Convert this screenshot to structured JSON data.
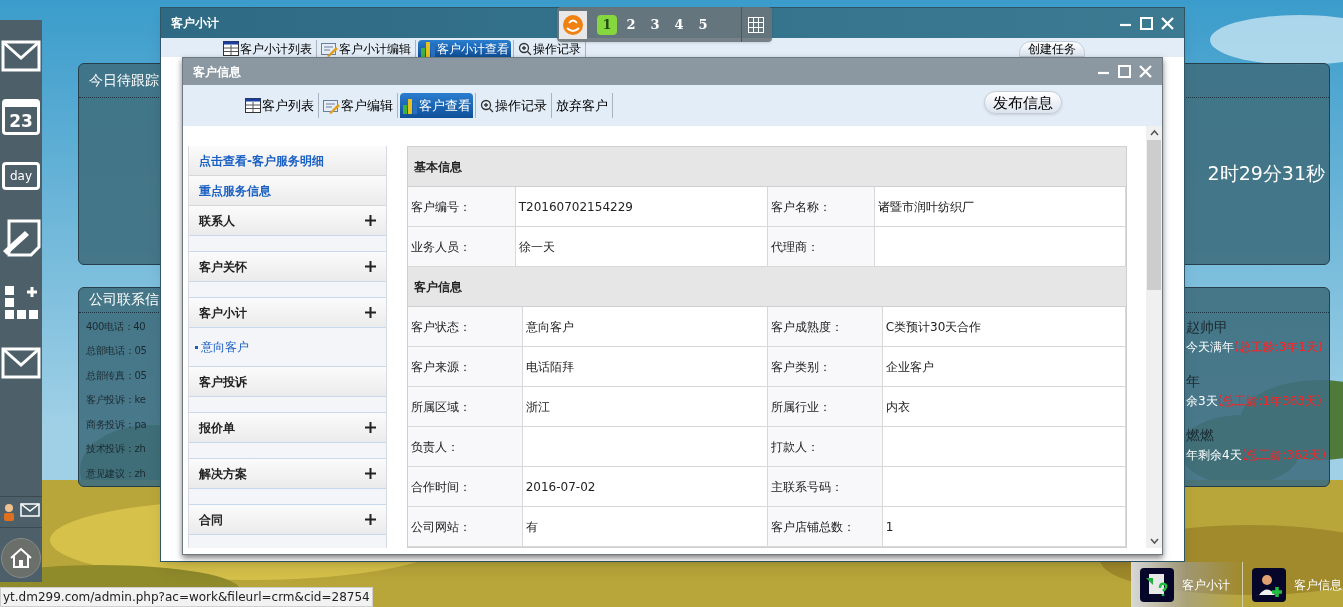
{
  "dock": [
    {
      "kind": "mail"
    },
    {
      "kind": "calendar",
      "label": "23"
    },
    {
      "kind": "day",
      "label": "day"
    },
    {
      "kind": "note"
    },
    {
      "kind": "apps"
    },
    {
      "kind": "mail"
    }
  ],
  "desktop_panels": [
    {
      "title": "今日待跟踪",
      "timer": "2时29分31秒"
    },
    {
      "title": "公司联系信",
      "contacts": [
        "400电话：40",
        "总部电话：05",
        "总部传真：05",
        "客户投诉：ke",
        "商务投诉：pa",
        "技术投诉：zh",
        "意见建议：zh"
      ],
      "anniversaries": [
        {
          "name": "赵帅甲",
          "note": "今天满年",
          "tenure": "(总工龄:3年1天)"
        },
        {
          "name": "年",
          "note": "余3天",
          "tenure": "(总工龄:1年363天)"
        },
        {
          "name": "燃燃",
          "note": "年剩余4天",
          "tenure": "(总工龄:362天)"
        }
      ]
    }
  ],
  "workspace_switcher": [
    {
      "label": "1",
      "selected": true
    },
    {
      "label": "2",
      "selected": false
    },
    {
      "label": "3",
      "selected": false
    },
    {
      "label": "4",
      "selected": false
    },
    {
      "label": "5",
      "selected": false
    }
  ],
  "outer_window": {
    "title": "客户小计",
    "action_button": "创建任务",
    "tabs": [
      {
        "label": "客户小计列表",
        "kind": "table",
        "selected": false
      },
      {
        "label": "客户小计编辑",
        "kind": "edit",
        "selected": false
      },
      {
        "label": "客户小计查看",
        "kind": "view",
        "selected": true
      },
      {
        "label": "操作记录",
        "kind": "zoom",
        "selected": false
      }
    ]
  },
  "inner_window": {
    "title": "客户信息",
    "action_button": "发布信息",
    "tabs": [
      {
        "label": "客户列表",
        "kind": "table",
        "selected": false
      },
      {
        "label": "客户编辑",
        "kind": "edit",
        "selected": false
      },
      {
        "label": "客户查看",
        "kind": "view",
        "selected": true
      },
      {
        "label": "操作记录",
        "kind": "zoom",
        "selected": false
      },
      {
        "label": "放弃客户",
        "kind": "plain",
        "selected": false
      }
    ],
    "sidebar": [
      {
        "label": "点击查看-客户服务明细",
        "kind": "link"
      },
      {
        "label": "重点服务信息",
        "kind": "link"
      },
      {
        "label": "联系人",
        "kind": "section",
        "expandable": true
      },
      {
        "label": "客户关怀",
        "kind": "section",
        "expandable": true
      },
      {
        "label": "客户小计",
        "kind": "section",
        "expandable": true,
        "children": [
          {
            "label": "意向客户"
          }
        ]
      },
      {
        "label": "客户投诉",
        "kind": "section",
        "expandable": false
      },
      {
        "label": "报价单",
        "kind": "section",
        "expandable": true
      },
      {
        "label": "解决方案",
        "kind": "section",
        "expandable": true
      },
      {
        "label": "合同",
        "kind": "section",
        "expandable": true
      }
    ],
    "details": [
      {
        "title": "基本信息",
        "rows": [
          [
            "客户编号：",
            "T20160702154229",
            "客户名称：",
            "诸暨市润叶纺织厂"
          ],
          [
            "业务人员：",
            "徐一天",
            "代理商：",
            ""
          ]
        ]
      },
      {
        "title": "客户信息",
        "rows": [
          [
            "客户状态：",
            "意向客户",
            "客户成熟度：",
            "C类预计30天合作"
          ],
          [
            "客户来源：",
            "电话陌拜",
            "客户类别：",
            "企业客户"
          ],
          [
            "所属区域：",
            "浙江",
            "所属行业：",
            "内衣"
          ],
          [
            "负责人：",
            "",
            "打款人：",
            ""
          ],
          [
            "合作时间：",
            "2016-07-02",
            "主联系号码：",
            ""
          ],
          [
            "公司网站：",
            "有",
            "客户店铺总数：",
            "1"
          ]
        ]
      }
    ]
  },
  "taskbar": [
    {
      "label": "客户小计",
      "kind": "document",
      "selected": true
    },
    {
      "label": "客户信息",
      "kind": "person",
      "selected": false
    }
  ],
  "status_bar": "yt.dm299.com/admin.php?ac=work&fileurl=crm&cid=28754"
}
